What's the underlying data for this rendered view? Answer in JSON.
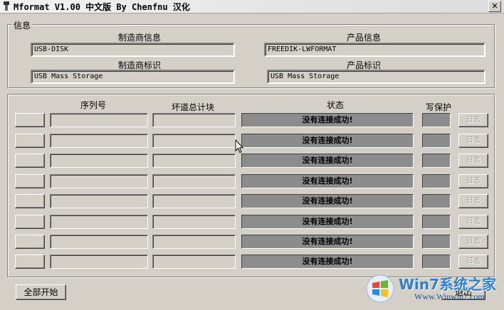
{
  "window": {
    "title": "Mformat V1.00 中文版 By Chenfnu 汉化",
    "close_glyph": "✕"
  },
  "info": {
    "caption": "信息",
    "manufacturer_info_label": "制造商信息",
    "manufacturer_info_value": "USB-DISK",
    "product_info_label": "产品信息",
    "product_info_value": "FREEDIK-LWFORMAT",
    "manufacturer_id_label": "制造商标识",
    "manufacturer_id_value": "USB Mass Storage",
    "product_id_label": "产品标识",
    "product_id_value": "USB Mass Storage"
  },
  "table": {
    "headers": {
      "serial": "序列号",
      "bad_blocks": "坏道总计块",
      "status": "状态",
      "write_protect": "写保护"
    },
    "rows": [
      {
        "status": "没有连接成功!",
        "log": "日志"
      },
      {
        "status": "没有连接成功!",
        "log": "日志"
      },
      {
        "status": "没有连接成功!",
        "log": "日志"
      },
      {
        "status": "没有连接成功!",
        "log": "日志"
      },
      {
        "status": "没有连接成功!",
        "log": "日志"
      },
      {
        "status": "没有连接成功!",
        "log": "日志"
      },
      {
        "status": "没有连接成功!",
        "log": "日志"
      },
      {
        "status": "没有连接成功!",
        "log": "日志"
      }
    ]
  },
  "footer": {
    "start_all": "全部开始",
    "exit": "退出"
  },
  "watermark": {
    "brand": "Win7系统之家",
    "url": "Www.Winwin7.com"
  },
  "icons": {
    "app": "app-icon",
    "cursor": "mouse-cursor-icon",
    "watermark_logo": "windows-logo-icon"
  }
}
